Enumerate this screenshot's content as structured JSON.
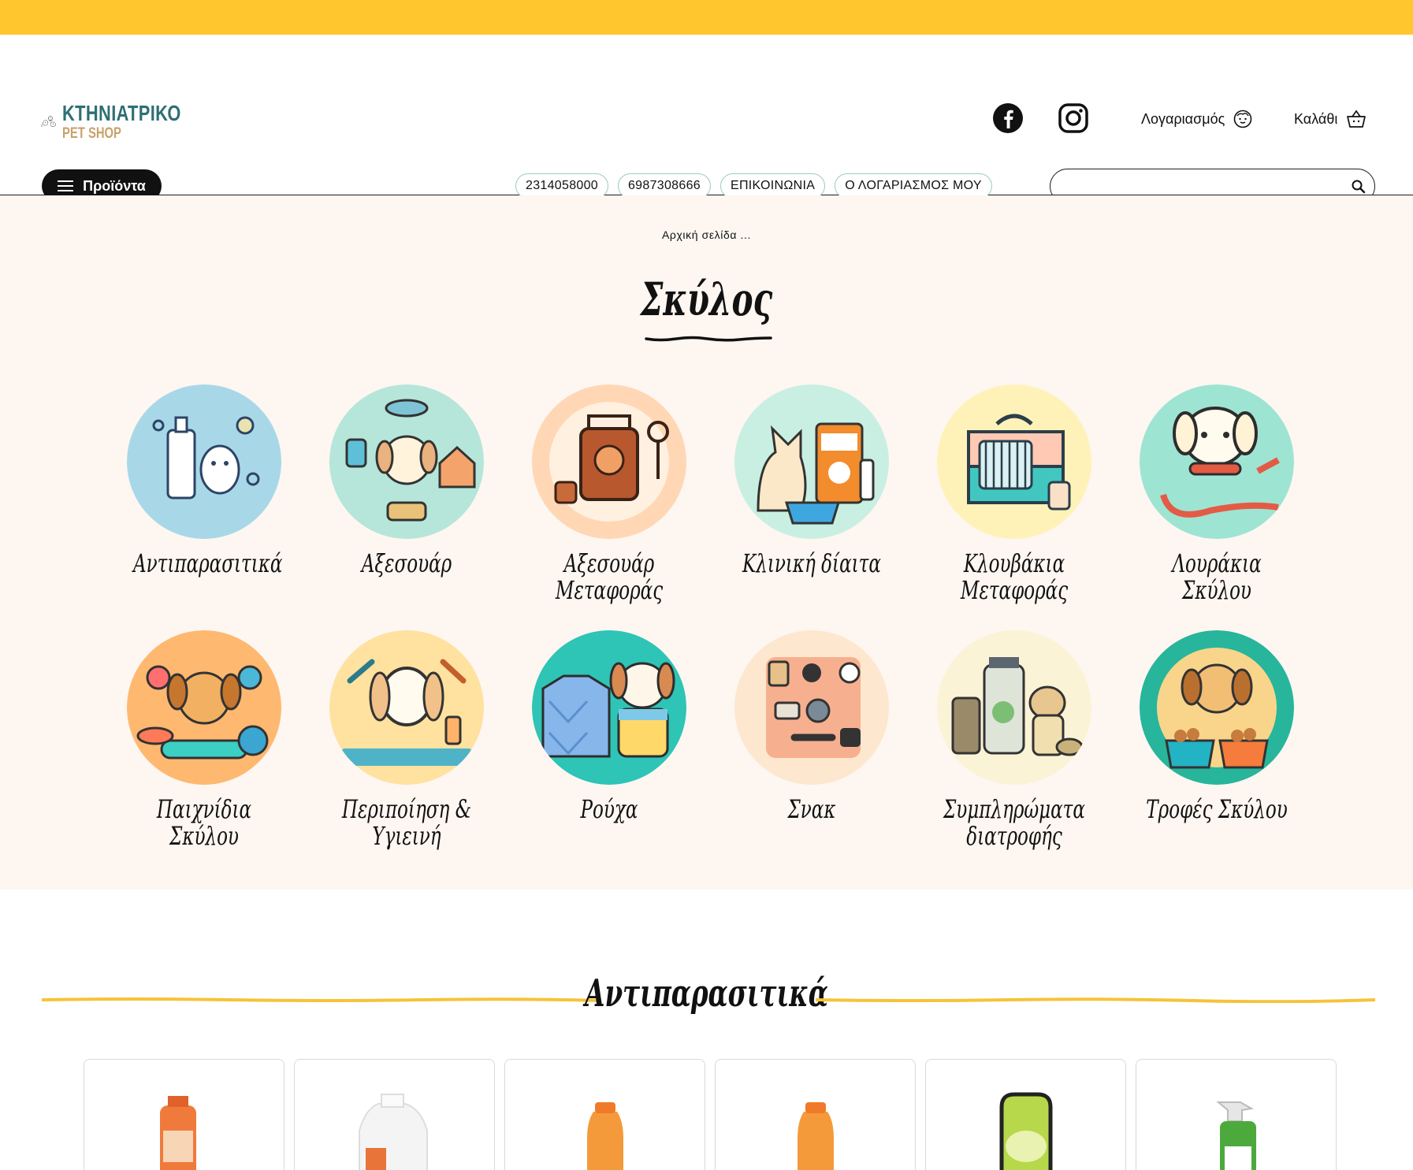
{
  "brand": {
    "line1": "ΚΤΗΝΙΑΤΡΙΚΟ",
    "line2": "PET SHOP"
  },
  "header": {
    "account_label": "Λογαριασμός",
    "cart_label": "Καλάθι",
    "products_button": "Προϊόντα",
    "links": [
      "2314058000",
      "6987308666",
      "ΕΠΙΚΟΙΝΩΝΙΑ",
      "Ο ΛΟΓΑΡΙΑΣΜΟΣ ΜΟΥ"
    ],
    "search_placeholder": ""
  },
  "colors": {
    "topbar": "#ffc62e",
    "accent": "#f6c338",
    "section_bg": "#fdf6f1",
    "pill_border": "#9ccbbd"
  },
  "breadcrumb": "Αρχική σελίδα ...",
  "category_title": "Σκύλος",
  "categories": [
    {
      "label": "Αντιπαρασιτικά",
      "icon": "antiparasitic-icon",
      "bg": "#a8d8e8"
    },
    {
      "label": "Αξεσουάρ",
      "icon": "accessories-icon",
      "bg": "#b5e6d9"
    },
    {
      "label": "Αξεσουάρ Μεταφοράς",
      "icon": "transport-accessories-icon",
      "bg": "#ffd7b5"
    },
    {
      "label": "Κλινική δίαιτα",
      "icon": "clinical-diet-icon",
      "bg": "#c8efe2"
    },
    {
      "label": "Κλουβάκια Μεταφοράς",
      "icon": "carrier-crate-icon",
      "bg": "#fff2b8"
    },
    {
      "label": "Λουράκια Σκύλου",
      "icon": "dog-leash-icon",
      "bg": "#9ee4d2"
    },
    {
      "label": "Παιχνίδια Σκύλου",
      "icon": "dog-toys-icon",
      "bg": "#ffb870"
    },
    {
      "label": "Περιποίηση & Υγιεινή",
      "icon": "grooming-icon",
      "bg": "#ffe1a0"
    },
    {
      "label": "Ρούχα",
      "icon": "clothes-icon",
      "bg": "#2ec4b6"
    },
    {
      "label": "Σνακ",
      "icon": "snacks-icon",
      "bg": "#fde7cf"
    },
    {
      "label": "Συμπληρώματα διατροφής",
      "icon": "supplements-icon",
      "bg": "#fbf3d6"
    },
    {
      "label": "Τροφές Σκύλου",
      "icon": "dog-food-icon",
      "bg": "#27b59b"
    }
  ],
  "featured_section": {
    "title": "Αντιπαρασιτικά",
    "products": [
      {
        "image": "spray-can-orange"
      },
      {
        "image": "white-bottle"
      },
      {
        "image": "orange-shampoo-bottle"
      },
      {
        "image": "orange-shampoo-bottle"
      },
      {
        "image": "green-jar"
      },
      {
        "image": "green-spray-bottle"
      }
    ]
  }
}
